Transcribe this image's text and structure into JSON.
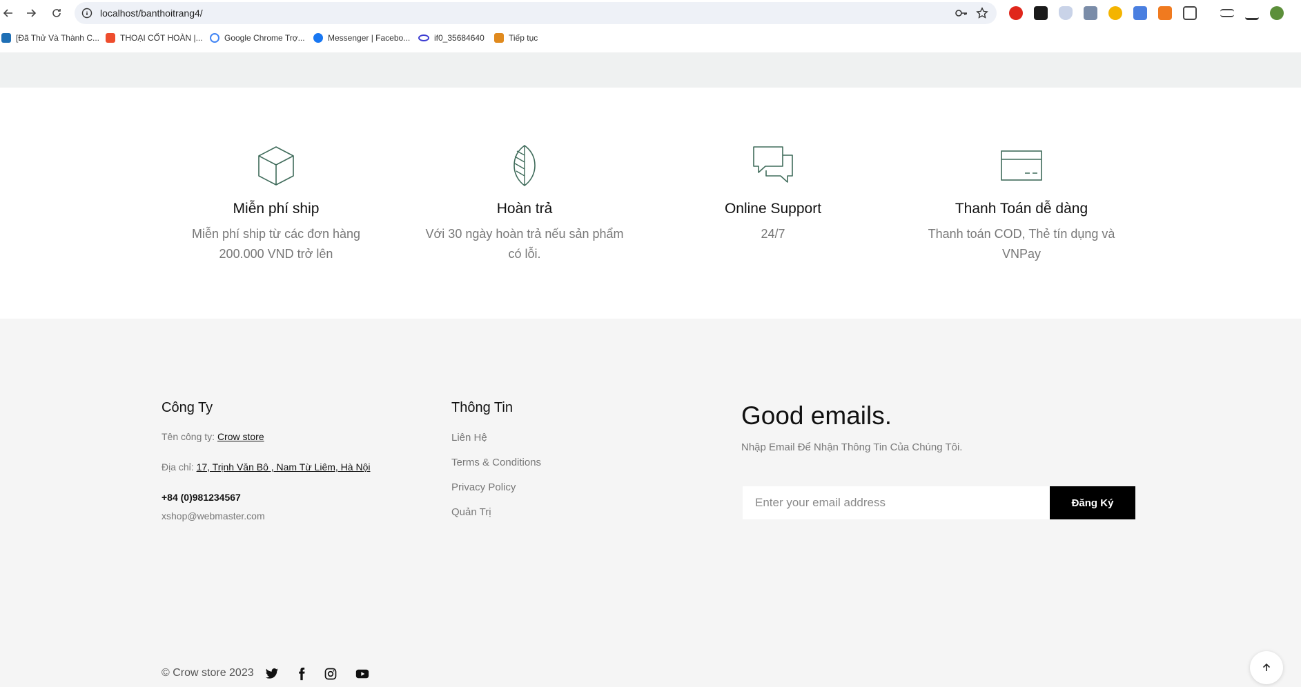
{
  "browser": {
    "url": "localhost/banthoitrang4/",
    "bookmarks": [
      {
        "label": "[Đã Thử Và Thành C...",
        "color": "#1f6fb5"
      },
      {
        "label": "THOẠI CỐT HOÀN |...",
        "color": "#ee4d2d"
      },
      {
        "label": "Google Chrome Trợ...",
        "color": "#4285f4"
      },
      {
        "label": "Messenger | Facebo...",
        "color": "#1877f2"
      },
      {
        "label": "if0_35684640",
        "color": "#3b3bd1"
      },
      {
        "label": "Tiếp tục",
        "color": "#e08a1e"
      }
    ]
  },
  "features": [
    {
      "title": "Miễn phí ship",
      "desc_line1": "Miễn phí ship từ các đơn hàng",
      "desc_line2": "200.000 VND trở lên",
      "icon": "box-icon"
    },
    {
      "title": "Hoàn trả",
      "desc_line1": "Với 30 ngày hoàn trả nếu sản phẩm",
      "desc_line2": "có lỗi.",
      "icon": "leaf-icon"
    },
    {
      "title": "Online Support",
      "desc_line1": "24/7",
      "desc_line2": "",
      "icon": "chat-icon"
    },
    {
      "title": "Thanh Toán dễ dàng",
      "desc_line1": "Thanh toán COD, Thẻ tín dụng và",
      "desc_line2": "VNPay",
      "icon": "credit-card-icon"
    }
  ],
  "footer": {
    "company": {
      "title": "Công Ty",
      "name_label": "Tên công ty:",
      "name_value": "Crow store",
      "address_label": "Địa chỉ:",
      "address_value": "17, Trịnh Văn Bô , Nam Từ Liêm, Hà Nội",
      "phone": "+84 (0)981234567",
      "email": "xshop@webmaster.com"
    },
    "info": {
      "title": "Thông Tin",
      "links": [
        "Liên Hệ",
        "Terms & Conditions",
        "Privacy Policy",
        "Quản Trị"
      ]
    },
    "newsletter": {
      "title": "Good emails.",
      "subtitle": "Nhập Email Để Nhận Thông Tin Của Chúng Tôi.",
      "placeholder": "Enter your email address",
      "button": "Đăng Ký"
    },
    "copyright": "© Crow store 2023"
  },
  "colors": {
    "icon_green": "#3f6b5a",
    "muted_text": "#777777",
    "footer_bg": "#f5f5f5"
  }
}
